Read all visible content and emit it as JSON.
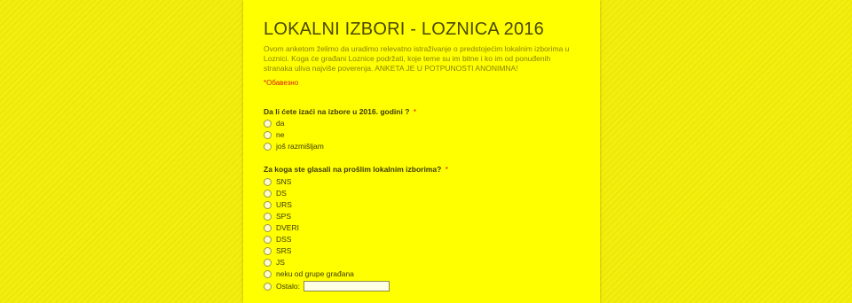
{
  "form": {
    "title": "LOKALNI IZBORI - LOZNICA 2016",
    "description": "Ovom anketom želimo da uradimo relevatno istraživanje o predstojećim lokalnim izborima u Loznici. Koga će građani Loznice podržati, koje teme su im bitne i ko im od ponuđenih stranaka uliva najviše poverenja. ANKETA JE U POTPUNOSTI ANONIMNA!",
    "required_note": "*Обавезно"
  },
  "questions": [
    {
      "title": "Da li ćete izaći na izbore u 2016. godini ?",
      "required_mark": "*",
      "options": [
        "da",
        "ne",
        "još razmišljam"
      ]
    },
    {
      "title": "Za koga ste glasali na prošlim lokalnim izborima?",
      "required_mark": "*",
      "options": [
        "SNS",
        "DS",
        "URS",
        "SPS",
        "DVERI",
        "DSS",
        "SRS",
        "JS",
        "neku od grupe građana",
        "Ostalo:"
      ]
    }
  ],
  "colors": {
    "background": "#f4ee0c",
    "card": "#ffff00",
    "required": "#d81b0f"
  }
}
